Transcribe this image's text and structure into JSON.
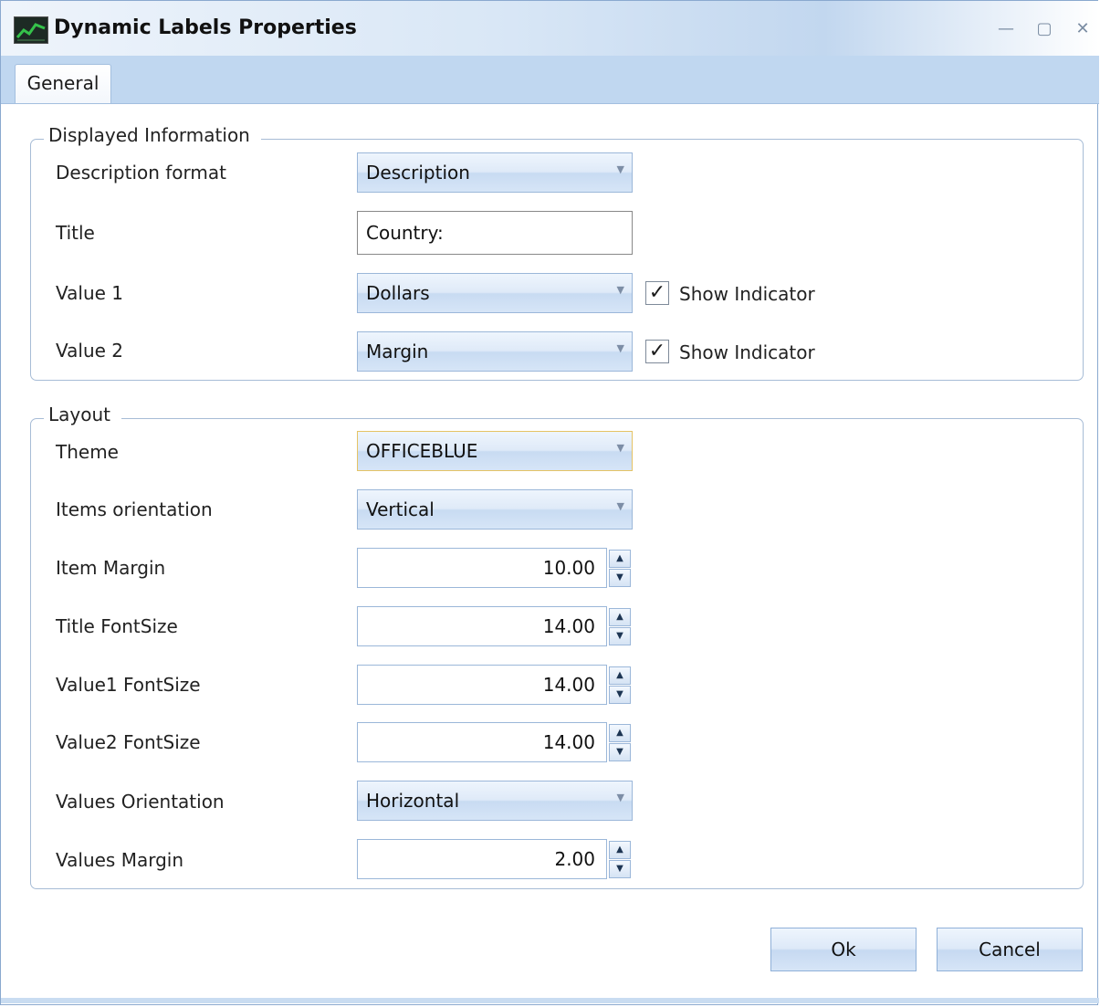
{
  "window": {
    "title": "Dynamic Labels Properties",
    "controls": {
      "minimize": "—",
      "maximize": "▢",
      "close": "✕"
    }
  },
  "tabs": [
    {
      "label": "General",
      "selected": true
    }
  ],
  "displayed_information": {
    "legend": "Displayed Information",
    "description_format": {
      "label": "Description format",
      "value": "Description"
    },
    "title": {
      "label": "Title",
      "value": "Country:"
    },
    "value1": {
      "label": "Value 1",
      "value": "Dollars",
      "show_indicator": true,
      "indicator_label": "Show Indicator"
    },
    "value2": {
      "label": "Value 2",
      "value": "Margin",
      "show_indicator": true,
      "indicator_label": "Show Indicator"
    }
  },
  "layout": {
    "legend": "Layout",
    "theme": {
      "label": "Theme",
      "value": "OFFICEBLUE"
    },
    "items_orientation": {
      "label": "Items orientation",
      "value": "Vertical"
    },
    "item_margin": {
      "label": "Item Margin",
      "value": "10.00"
    },
    "title_fontsize": {
      "label": "Title FontSize",
      "value": "14.00"
    },
    "value1_fontsize": {
      "label": "Value1 FontSize",
      "value": "14.00"
    },
    "value2_fontsize": {
      "label": "Value2 FontSize",
      "value": "14.00"
    },
    "values_orientation": {
      "label": "Values Orientation",
      "value": "Horizontal"
    },
    "values_margin": {
      "label": "Values Margin",
      "value": "2.00"
    }
  },
  "buttons": {
    "ok": "Ok",
    "cancel": "Cancel"
  },
  "glyphs": {
    "dropdown": "▼",
    "spin_up": "▲",
    "spin_down": "▼",
    "check": "✓"
  },
  "colors": {
    "accent": "#c0d7f0",
    "focus_border": "#e5c365",
    "group_border": "#a7bcd6"
  }
}
